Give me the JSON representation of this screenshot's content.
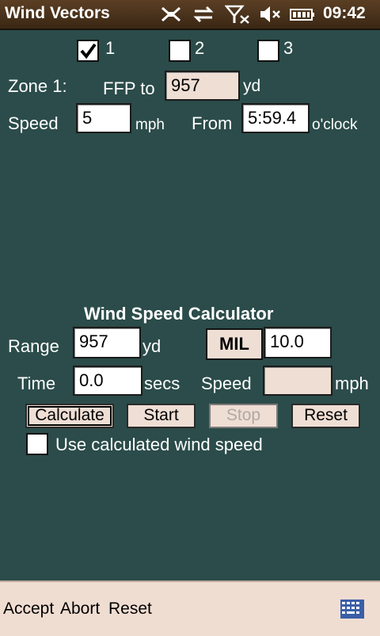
{
  "titlebar": {
    "app_title": "Wind Vectors",
    "time": "09:42",
    "status_icons": [
      "antenna-icon",
      "sync-arrows-icon",
      "signal-off-icon",
      "speaker-muted-icon",
      "battery-icon"
    ]
  },
  "zones": {
    "options": [
      {
        "label": "1",
        "checked": true
      },
      {
        "label": "2",
        "checked": false
      },
      {
        "label": "3",
        "checked": false
      }
    ]
  },
  "zone_panel": {
    "zone_label": "Zone 1:",
    "ffp_label": "FFP to",
    "ffp_value": "957",
    "ffp_unit": "yd",
    "speed_label": "Speed",
    "speed_value": "5",
    "speed_unit": "mph",
    "from_label": "From",
    "from_value": "5:59.4",
    "from_unit": "o'clock"
  },
  "calculator": {
    "title": "Wind Speed Calculator",
    "range_label": "Range",
    "range_value": "957",
    "range_unit": "yd",
    "mil_label": "MIL",
    "mil_value": "10.0",
    "time_label": "Time",
    "time_value": "0.0",
    "time_unit": "secs",
    "speed_label": "Speed",
    "speed_value": "",
    "speed_unit": "mph",
    "buttons": {
      "calculate": "Calculate",
      "start": "Start",
      "stop": "Stop",
      "reset": "Reset"
    },
    "use_calc_label": "Use calculated wind speed",
    "use_calc_checked": false
  },
  "menubar": {
    "accept": "Accept",
    "abort": "Abort",
    "reset": "Reset",
    "keyboard_icon": "keyboard-icon"
  },
  "colors": {
    "background": "#2b4c4a",
    "titlebar": "#4a321c",
    "field_readonly": "#efded4",
    "menubar": "#f0ddd2"
  }
}
